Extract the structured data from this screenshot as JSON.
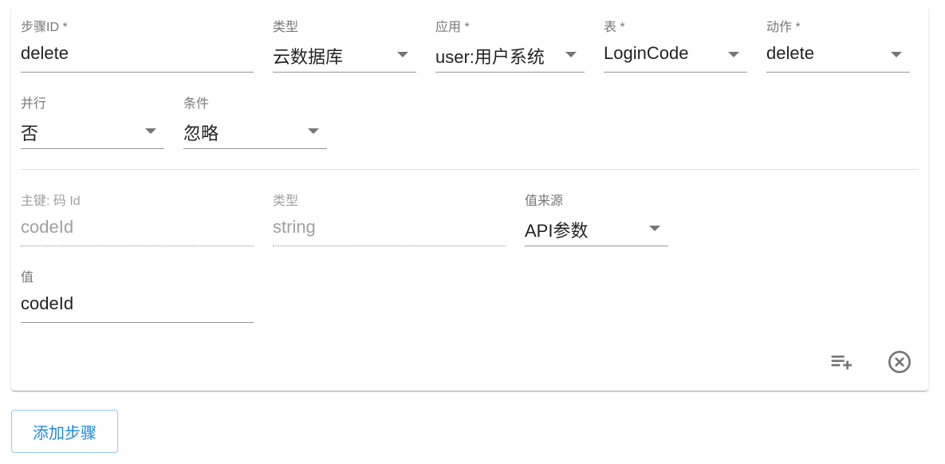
{
  "step": {
    "step_id": {
      "label": "步骤ID *",
      "value": "delete"
    },
    "type": {
      "label": "类型",
      "value": "云数据库"
    },
    "app": {
      "label": "应用 *",
      "value": "user:用户系统"
    },
    "table": {
      "label": "表 *",
      "value": "LoginCode"
    },
    "action": {
      "label": "动作 *",
      "value": "delete"
    },
    "parallel": {
      "label": "并行",
      "value": "否"
    },
    "condition": {
      "label": "条件",
      "value": "忽略"
    }
  },
  "param": {
    "primary_key": {
      "label": "主键: 码 Id",
      "value": "codeId"
    },
    "param_type": {
      "label": "类型",
      "value": "string"
    },
    "value_source": {
      "label": "值来源",
      "value": "API参数"
    },
    "value": {
      "label": "值",
      "value": "codeId"
    }
  },
  "actions": {
    "add_param_icon": "playlist-add-icon",
    "remove_icon": "close-circle-icon"
  },
  "add_step_button": "添加步骤",
  "colors": {
    "accent": "#1e88e5",
    "text": "#212121",
    "muted": "#8a8a8a"
  }
}
